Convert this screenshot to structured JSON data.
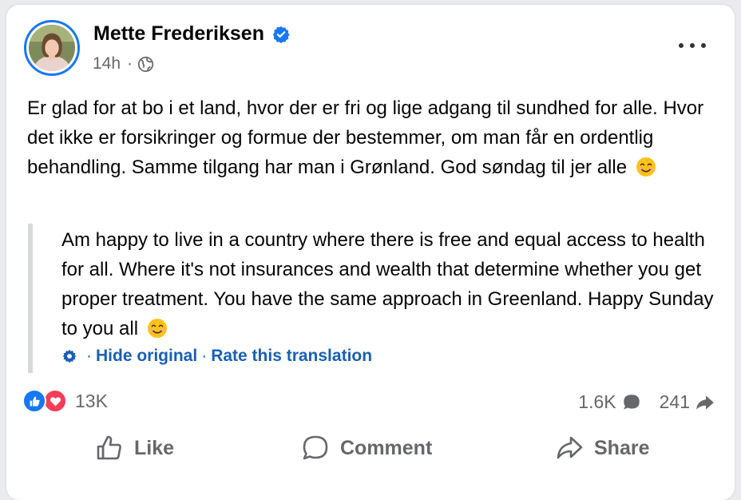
{
  "post": {
    "author": "Mette Frederiksen",
    "time": "14h",
    "meta_separator": "·",
    "text_original": "Er glad for at bo i et land, hvor der er fri og lige adgang til sundhed for alle. Hvor det ikke er forsikringer og formue der bestemmer, om man får en ordentlig behandling. Samme tilgang har man i Grønland. God søndag til jer alle",
    "text_translation": "Am happy to live in a country where there is free and equal access to health for all. Where it's not insurances and wealth that determine whether you get proper treatment. You have the same approach in Greenland. Happy Sunday to you all",
    "emoji_icon": "smiling-face-icon"
  },
  "translation_links": {
    "hide_original": "Hide original",
    "separator": "·",
    "rate_translation": "Rate this translation"
  },
  "engagement": {
    "reaction_count": "13K",
    "reaction_types": [
      "like",
      "love"
    ],
    "comment_count": "1.6K",
    "share_count": "241"
  },
  "actions": {
    "like": "Like",
    "comment": "Comment",
    "share": "Share"
  },
  "colors": {
    "brand_blue": "#1877f2",
    "link_blue": "#1a5fb4",
    "love_red": "#f33e58",
    "muted_text": "#65676b"
  }
}
